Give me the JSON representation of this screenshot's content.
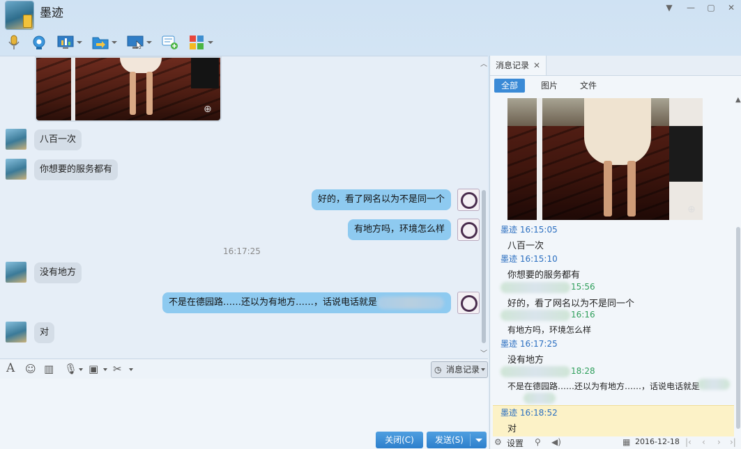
{
  "window": {
    "contact_name": "墨迹"
  },
  "colors": {
    "bubble_out": "#8ecaf0",
    "bubble_in": "#d4dde7",
    "button_blue": "#2d7fcc",
    "history_name": "#2a6ec0",
    "history_name_alt": "#2e9e5a",
    "highlight": "#fcf2c7"
  },
  "toolbar": {
    "icons": [
      "microphone-icon",
      "video-call-icon",
      "screen-share-icon",
      "file-transfer-icon",
      "remote-desktop-icon",
      "group-chat-icon",
      "apps-icon"
    ]
  },
  "chat": {
    "messages": [
      {
        "from": "contact",
        "text": "八百一次"
      },
      {
        "from": "contact",
        "text": "你想要的服务都有"
      },
      {
        "from": "me",
        "text": "好的，看了网名以为不是同一个"
      },
      {
        "from": "me",
        "text": "有地方吗，环境怎么样"
      },
      {
        "from": "contact",
        "text": "没有地方"
      },
      {
        "from": "me",
        "text": "不是在德园路……还以为有地方……，话说电话就是"
      },
      {
        "from": "contact",
        "text": "对"
      }
    ],
    "time_divider": "16:17:25"
  },
  "input_toolbar": {
    "history_button": "消息记录"
  },
  "buttons": {
    "close": "关闭(C)",
    "send": "发送(S)"
  },
  "history": {
    "tab_title": "消息记录",
    "filters": [
      "全部",
      "图片",
      "文件"
    ],
    "records": [
      {
        "name": "墨迹",
        "time": "16:15:05",
        "text": "八百一次"
      },
      {
        "name": "墨迹",
        "time": "16:15:10",
        "text": "你想要的服务都有"
      },
      {
        "name": "",
        "time": "15:56",
        "text": "好的，看了网名以为不是同一个"
      },
      {
        "name": "",
        "time": "16:16",
        "text": "有地方吗，环境怎么样"
      },
      {
        "name": "墨迹",
        "time": "16:17:25",
        "text": "没有地方"
      },
      {
        "name": "",
        "time": "18:28",
        "text": "不是在德园路……还以为有地方……，话说电话就是"
      },
      {
        "name": "墨迹",
        "time": "16:18:52",
        "text": "对"
      }
    ],
    "footer": {
      "settings": "设置",
      "date": "2016-12-18"
    }
  }
}
